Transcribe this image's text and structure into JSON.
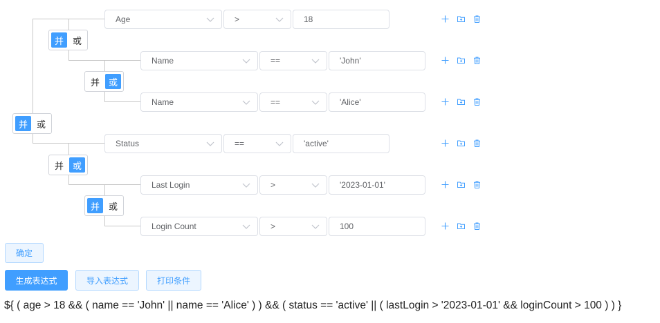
{
  "logic": {
    "and": "并",
    "or": "或"
  },
  "groups": {
    "root": {
      "active": "and"
    },
    "g1": {
      "active": "and"
    },
    "g1_1": {
      "active": "or"
    },
    "g2": {
      "active": "or"
    },
    "g2_1": {
      "active": "and"
    }
  },
  "conditions": [
    {
      "field": "Age",
      "op": ">",
      "value": "18"
    },
    {
      "field": "Name",
      "op": "==",
      "value": "'John'"
    },
    {
      "field": "Name",
      "op": "==",
      "value": "'Alice'"
    },
    {
      "field": "Status",
      "op": "==",
      "value": "'active'"
    },
    {
      "field": "Last Login",
      "op": ">",
      "value": "'2023-01-01'"
    },
    {
      "field": "Login Count",
      "op": ">",
      "value": "100"
    }
  ],
  "icons": {
    "add": "plus-icon",
    "add_group": "folder-plus-icon",
    "delete": "trash-icon"
  },
  "buttons": {
    "confirm": "确定",
    "generate": "生成表达式",
    "import": "导入表达式",
    "print": "打印条件"
  },
  "expression": "${ ( age > 18 && ( name == 'John' || name == 'Alice' ) ) && ( status == 'active' || ( lastLogin > '2023-01-01' && loginCount > 100 ) ) }",
  "colors": {
    "accent": "#409eff",
    "line": "#c6c6c6",
    "border": "#dcdfe6"
  }
}
